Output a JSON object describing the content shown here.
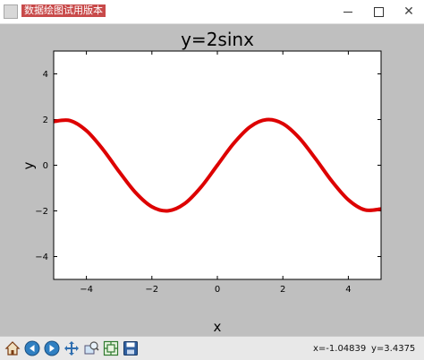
{
  "window": {
    "title": "数据绘图试用版本",
    "minimize_label": "—",
    "close_label": "✕"
  },
  "toolbar": {
    "tools": [
      {
        "name": "home-icon"
      },
      {
        "name": "back-icon"
      },
      {
        "name": "forward-icon"
      },
      {
        "name": "pan-icon"
      },
      {
        "name": "zoom-icon"
      },
      {
        "name": "subplots-icon"
      },
      {
        "name": "save-icon"
      }
    ],
    "x_readout": "x=-1.04839",
    "y_readout": "y=3.4375"
  },
  "colors": {
    "curve": "#dd0000",
    "figure_bg": "#bfbfbf",
    "axes_bg": "#ffffff"
  },
  "chart_data": {
    "type": "line",
    "title": "y=2sinx",
    "xlabel": "x",
    "ylabel": "y",
    "xlim": [
      -5,
      5
    ],
    "ylim": [
      -5,
      5
    ],
    "xticks": [
      -4,
      -2,
      0,
      2,
      4
    ],
    "yticks": [
      -4,
      -2,
      0,
      2,
      4
    ],
    "xtick_labels": [
      "−4",
      "−2",
      "0",
      "2",
      "4"
    ],
    "ytick_labels": [
      "−4",
      "−2",
      "0",
      "2",
      "4"
    ],
    "grid": false,
    "series": [
      {
        "color": "#dd0000",
        "x": [
          -5.0,
          -4.5,
          -4.0,
          -3.5,
          -3.0,
          -2.5,
          -2.0,
          -1.5,
          -1.0,
          -0.5,
          0.0,
          0.5,
          1.0,
          1.5,
          2.0,
          2.5,
          3.0,
          3.5,
          4.0,
          4.5,
          5.0
        ],
        "y": [
          1.918,
          1.955,
          1.514,
          0.702,
          -0.282,
          -1.197,
          -1.819,
          -1.995,
          -1.683,
          -0.959,
          0.0,
          0.959,
          1.683,
          1.995,
          1.819,
          1.197,
          0.282,
          -0.702,
          -1.514,
          -1.955,
          -1.918
        ]
      }
    ]
  }
}
